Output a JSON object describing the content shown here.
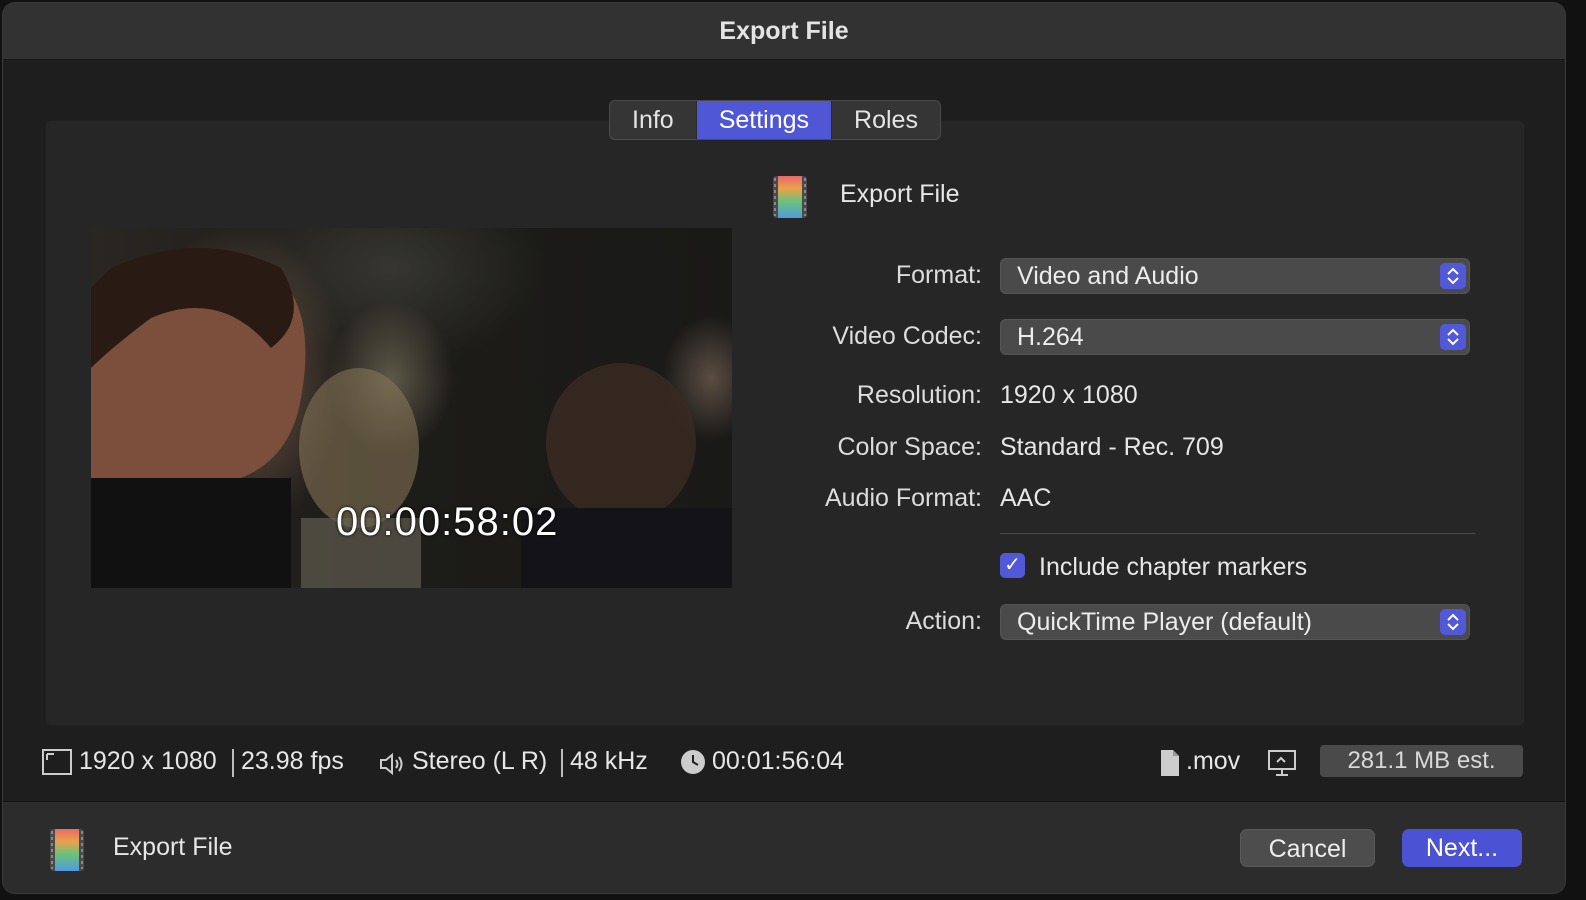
{
  "window": {
    "title": "Export File"
  },
  "tabs": [
    {
      "label": "Info",
      "active": false
    },
    {
      "label": "Settings",
      "active": true
    },
    {
      "label": "Roles",
      "active": false
    }
  ],
  "preview": {
    "timecode": "00:00:58:02"
  },
  "settings": {
    "header_title": "Export File",
    "format": {
      "label": "Format:",
      "value": "Video and Audio"
    },
    "video_codec": {
      "label": "Video Codec:",
      "value": "H.264"
    },
    "resolution": {
      "label": "Resolution:",
      "value": "1920 x 1080"
    },
    "color_space": {
      "label": "Color Space:",
      "value": "Standard - Rec. 709"
    },
    "audio_format": {
      "label": "Audio Format:",
      "value": "AAC"
    },
    "chapter_markers": {
      "label": "Include chapter markers",
      "checked": true
    },
    "action": {
      "label": "Action:",
      "value": "QuickTime Player (default)"
    }
  },
  "status": {
    "resolution": "1920 x 1080",
    "fps": "23.98 fps",
    "audio": "Stereo (L R)",
    "sample_rate": "48 kHz",
    "duration": "00:01:56:04",
    "extension": ".mov",
    "size_estimate": "281.1 MB est."
  },
  "footer": {
    "destination_label": "Export File",
    "cancel_label": "Cancel",
    "next_label": "Next..."
  },
  "colors": {
    "accent": "#5159d8",
    "window_bg": "#1e1e1e",
    "panel_bg": "#262626"
  }
}
